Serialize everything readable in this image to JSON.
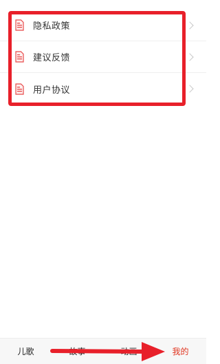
{
  "menu": {
    "items": [
      {
        "label": "隐私政策",
        "icon": "document-icon"
      },
      {
        "label": "建议反馈",
        "icon": "document-icon"
      },
      {
        "label": "用户协议",
        "icon": "document-icon"
      }
    ]
  },
  "tabbar": {
    "tabs": [
      {
        "label": "儿歌",
        "active": false
      },
      {
        "label": "故事",
        "active": false
      },
      {
        "label": "动画",
        "active": false
      },
      {
        "label": "我的",
        "active": true
      }
    ]
  },
  "colors": {
    "accent": "#e0341f",
    "annotation": "#e8202a",
    "icon": "#e84a4a"
  }
}
